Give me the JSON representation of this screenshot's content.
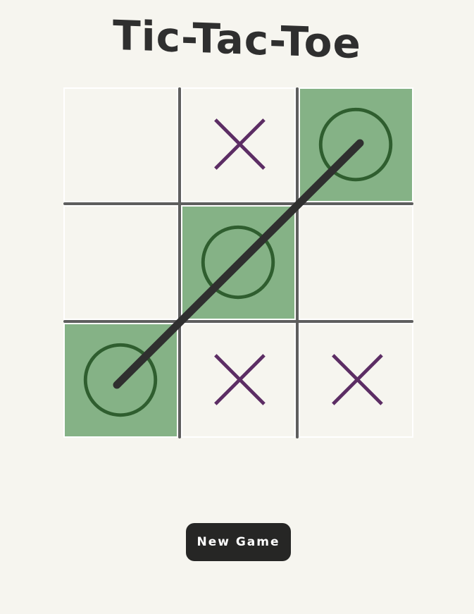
{
  "title": "Tic-Tac-Toe",
  "board": [
    "",
    "X",
    "O",
    "",
    "O",
    "",
    "O",
    "X",
    "X"
  ],
  "winning_cells": [
    2,
    4,
    6
  ],
  "new_game_label": "New Game",
  "colors": {
    "background": "#f6f5ef",
    "win_cell": "#85b286",
    "x_mark": "#5c2d64",
    "o_mark": "#2f5e2f",
    "grid": "#5e5e5e",
    "strike": "#2f2f2f",
    "button": "#262625"
  }
}
